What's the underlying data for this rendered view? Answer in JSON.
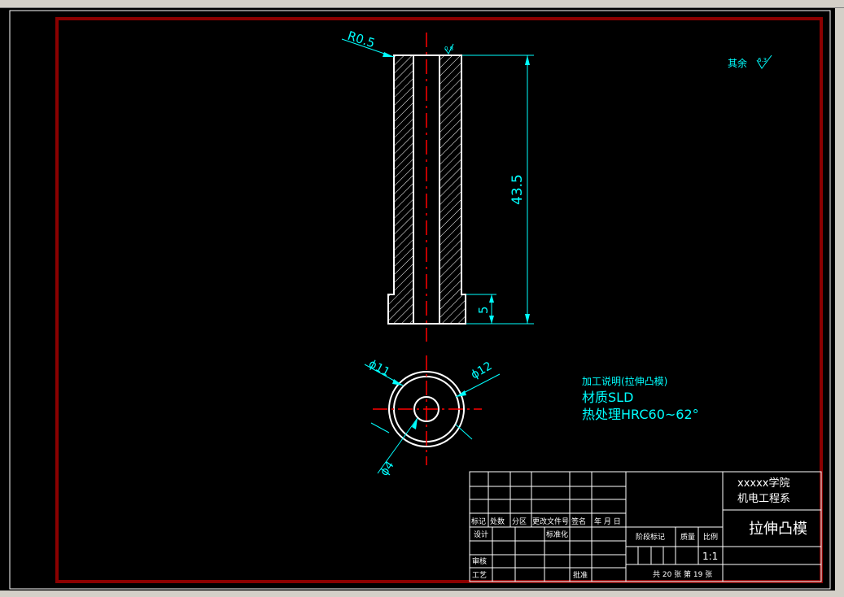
{
  "window": {
    "tabs": [
      "",
      "",
      "",
      "",
      "",
      ""
    ]
  },
  "dimensions": {
    "radius": "R0.5",
    "length": "43.5",
    "step": "5",
    "dia_small": "ϕ11",
    "dia_large": "ϕ12",
    "dia_hole": "ϕ4",
    "rough_top": "0.8"
  },
  "surface_note": {
    "label": "其余",
    "value": "6.3"
  },
  "notes": {
    "title": "加工说明(拉伸凸模)",
    "material": "材质SLD",
    "heat": "热处理HRC60~62°"
  },
  "title_block": {
    "headers": [
      "标记",
      "处数",
      "分区",
      "更改文件号",
      "签名",
      "年 月 日"
    ],
    "design": "设计",
    "standard": "标准化",
    "review": "审核",
    "process": "工艺",
    "approve": "批准",
    "stage": "阶段标记",
    "weight": "质量",
    "scale_label": "比例",
    "scale": "1:1",
    "sheets": "共 20 张 第 19 张",
    "school": "xxxxx学院",
    "dept": "机电工程系",
    "part_name": "拉伸凸模"
  },
  "colors": {
    "background": "#000000",
    "frame": "#8b0000",
    "outline": "#ffffff",
    "dimension": "#00ffff",
    "centerline": "#ff0000"
  }
}
